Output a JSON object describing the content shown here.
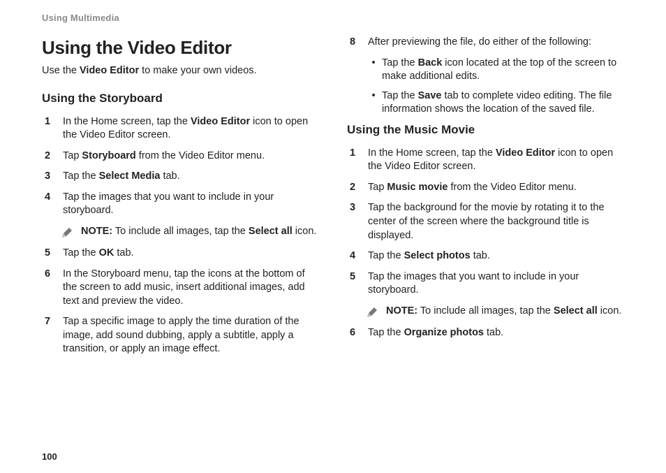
{
  "runningHead": "Using Multimedia",
  "pageNumber": "100",
  "left": {
    "title": "Using the Video Editor",
    "intro_pre": "Use the ",
    "intro_bold": "Video Editor",
    "intro_post": " to make your own videos.",
    "sub": "Using the Storyboard",
    "s1_pre": "In the Home screen, tap the ",
    "s1_bold": "Video Editor",
    "s1_post": " icon to open the Video Editor screen.",
    "s2_pre": "Tap ",
    "s2_bold": "Storyboard",
    "s2_post": " from the Video Editor menu.",
    "s3_pre": "Tap the ",
    "s3_bold": "Select Media",
    "s3_post": " tab.",
    "s4": "Tap the images that you want to include in your storyboard.",
    "note_label": "NOTE:",
    "note_mid": " To include all images, tap the ",
    "note_bold": "Select all",
    "note_post": " icon.",
    "s5_pre": "Tap the ",
    "s5_bold": "OK",
    "s5_post": " tab.",
    "s6": "In the Storyboard menu, tap the icons at the bottom of the screen to add music, insert additional images, add text and preview the video.",
    "s7": "Tap a specific image to apply the time duration of the image, add sound dubbing, apply a subtitle, apply a transition, or apply an image effect."
  },
  "right": {
    "s8_lead": "After previewing the file, do either of the following:",
    "b1_pre": "Tap the ",
    "b1_bold": "Back",
    "b1_post": " icon located at the top of the screen to make additional edits.",
    "b2_pre": "Tap the ",
    "b2_bold": "Save",
    "b2_post": " tab to complete video editing. The file information shows the location of the saved file.",
    "sub": "Using the Music Movie",
    "m1_pre": "In the Home screen, tap the ",
    "m1_bold": "Video Editor",
    "m1_post": " icon to open the Video Editor screen.",
    "m2_pre": "Tap ",
    "m2_bold": "Music movie",
    "m2_post": " from the Video Editor menu.",
    "m3": "Tap the background for the movie by rotating it to the center of the screen where the background title is displayed.",
    "m4_pre": "Tap the ",
    "m4_bold": "Select photos",
    "m4_post": " tab.",
    "m5": "Tap the images that you want to include in your storyboard.",
    "note_label": "NOTE:",
    "note_mid": " To include all images, tap the ",
    "note_bold": "Select all",
    "note_post": " icon.",
    "m6_pre": "Tap the ",
    "m6_bold": "Organize photos",
    "m6_post": " tab."
  },
  "nums": {
    "n1": "1",
    "n2": "2",
    "n3": "3",
    "n4": "4",
    "n5": "5",
    "n6": "6",
    "n7": "7",
    "n8": "8"
  },
  "bullet": "•"
}
